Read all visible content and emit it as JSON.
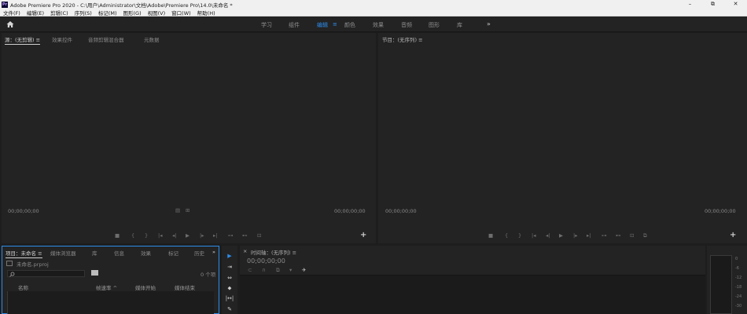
{
  "window": {
    "title": "Adobe Premiere Pro 2020 - C:\\用户\\Administrator\\文档\\Adobe\\Premiere Pro\\14.0\\未命名 *",
    "icon_text": "Pr",
    "minimize": "–",
    "maximize": "⧉",
    "close": "✕"
  },
  "menu": [
    "文件(F)",
    "编辑(E)",
    "剪辑(C)",
    "序列(S)",
    "标记(M)",
    "图形(G)",
    "视图(V)",
    "窗口(W)",
    "帮助(H)"
  ],
  "workspaces": {
    "tabs": [
      "学习",
      "组件",
      "编辑",
      "颜色",
      "效果",
      "音频",
      "图形",
      "库"
    ],
    "active": "编辑",
    "menu_icon": "≡",
    "more": "»"
  },
  "source_panel": {
    "tabs": [
      "源：(无剪辑)",
      "效果控件",
      "音频剪辑混合器",
      "元数据"
    ],
    "menu_icon": "≡",
    "timecode_left": "00;00;00;00",
    "timecode_right": "00;00;00;00",
    "controls": [
      "■",
      "{",
      "}",
      "|◂",
      "◂|",
      "▶",
      "|▸",
      "▸|",
      "⊶",
      "⊷",
      "⊡"
    ],
    "plus": "+"
  },
  "program_panel": {
    "tab": "节目：(无序列)",
    "menu_icon": "≡",
    "timecode_left": "00;00;00;00",
    "timecode_right": "00;00;00;00",
    "controls": [
      "■",
      "{",
      "}",
      "|◂",
      "◂|",
      "▶",
      "|▸",
      "▸|",
      "⊶",
      "⊷",
      "⊡",
      "⧉"
    ],
    "plus": "+"
  },
  "project_panel": {
    "tabs": [
      "项目：未命名",
      "媒体浏览器",
      "库",
      "信息",
      "效果",
      "标记",
      "历史"
    ],
    "menu_icon": "≡",
    "more": "»",
    "file": "未命名.prproj",
    "search_icon": "search-icon",
    "item_count": "0 个项",
    "columns": [
      "名称",
      "帧速率",
      "媒体开始",
      "媒体结束"
    ],
    "sort_indicator": "^"
  },
  "timeline_panel": {
    "tab": "时间轴：(无序列)",
    "menu_icon": "≡",
    "close": "×",
    "timecode": "00;00;00;00"
  },
  "tools": [
    "▶",
    "⇥",
    "⇔",
    "⬥",
    "|↔|",
    "✎"
  ],
  "audio_meter": {
    "ticks": [
      "0",
      "-6",
      "-12",
      "-18",
      "-24",
      "-30"
    ]
  },
  "colors": {
    "accent": "#2d8ceb",
    "panel_bg": "#232323",
    "chrome_bg": "#f0f0f0"
  }
}
